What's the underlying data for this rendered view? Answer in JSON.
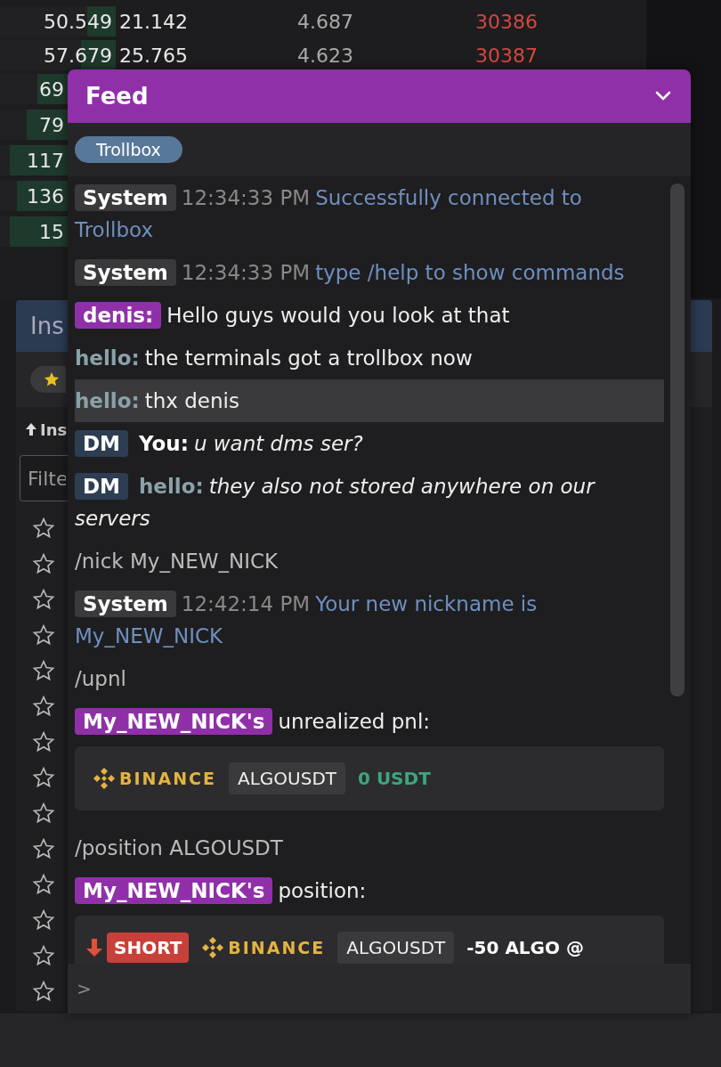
{
  "order_book": {
    "rows": [
      {
        "bid": "50.549",
        "bid_total": "21.142",
        "spread": "4.687",
        "ask": "30386",
        "level": 0.25
      },
      {
        "bid": "57.679",
        "bid_total": "25.765",
        "spread": "4.623",
        "ask": "30387",
        "level": 0.3
      },
      {
        "bid": "69",
        "level": 0.45
      },
      {
        "bid": "79",
        "level": 0.6
      },
      {
        "bid": "117",
        "level": 0.85
      },
      {
        "bid": "136",
        "level": 0.75
      },
      {
        "bid": "15",
        "level": 0.85
      }
    ]
  },
  "instruments": {
    "title": "Ins",
    "filter_chip": {
      "selected": true
    },
    "sort_label": "Ins",
    "filter": {
      "placeholder": "Filte"
    },
    "rows": [
      {
        "starred": false
      },
      {
        "starred": false
      },
      {
        "starred": false
      },
      {
        "starred": false
      },
      {
        "starred": false
      },
      {
        "starred": false
      },
      {
        "starred": false
      },
      {
        "starred": false
      },
      {
        "starred": false
      },
      {
        "starred": false
      },
      {
        "starred": false
      },
      {
        "starred": false
      },
      {
        "starred": false
      },
      {
        "starred": false
      }
    ]
  },
  "feed": {
    "title": "Feed",
    "expanded": true,
    "tabs": [
      {
        "label": "Trollbox",
        "selected": true
      }
    ],
    "messages": [
      {
        "kind": "system",
        "sender": "System",
        "time": "12:34:33 PM",
        "text": "Successfully connected to Trollbox"
      },
      {
        "kind": "system",
        "sender": "System",
        "time": "12:34:33 PM",
        "text": "type /help to show commands"
      },
      {
        "kind": "chat",
        "sender": "denis:",
        "badge": true,
        "selected": false,
        "text": "Hello guys would you look at that"
      },
      {
        "kind": "chat",
        "sender": "hello:",
        "badge": false,
        "selected": false,
        "text": "the terminals got a trollbox now"
      },
      {
        "kind": "chat",
        "sender": "hello:",
        "badge": false,
        "selected": true,
        "text": "thx denis"
      },
      {
        "kind": "dm",
        "tag": "DM",
        "sender": "You:",
        "own": true,
        "text": "u want dms ser?"
      },
      {
        "kind": "dm",
        "tag": "DM",
        "sender": "hello:",
        "own": false,
        "text": "they also not stored anywhere on our servers"
      },
      {
        "kind": "command",
        "text": "/nick My_NEW_NICK"
      },
      {
        "kind": "system",
        "sender": "System",
        "time": "12:42:14 PM",
        "text": "Your new nickname is My_NEW_NICK"
      },
      {
        "kind": "command",
        "text": "/upnl"
      },
      {
        "kind": "report",
        "sender": "My_NEW_NICK's",
        "text": "unrealized pnl:"
      },
      {
        "kind": "pnl_card",
        "exchange": "BINANCE",
        "symbol": "ALGOUSDT",
        "pnl": "0 USDT"
      },
      {
        "kind": "command",
        "text": "/position ALGOUSDT"
      },
      {
        "kind": "report",
        "sender": "My_NEW_NICK's",
        "text": "position:"
      },
      {
        "kind": "position_card",
        "short": true,
        "side": "SHORT",
        "exchange": "BINANCE",
        "symbol": "ALGOUSDT",
        "size": "-50 ALGO @"
      }
    ],
    "prompt": ">"
  }
}
